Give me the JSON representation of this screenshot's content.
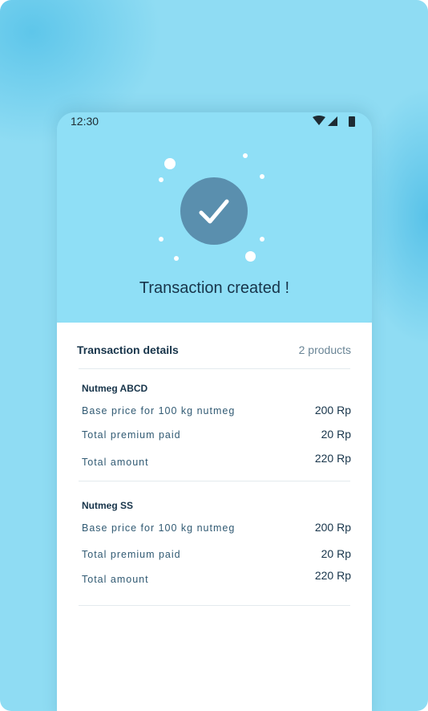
{
  "status_bar": {
    "time": "12:30",
    "icons": [
      "wifi-icon",
      "signal-icon",
      "battery-icon"
    ]
  },
  "hero": {
    "icon": "checkmark-icon",
    "title": "Transaction created !"
  },
  "details": {
    "title": "Transaction details",
    "count": "2 products",
    "products": [
      {
        "name": "Nutmeg ABCD",
        "rows": [
          {
            "label": "Base price for 100 kg nutmeg",
            "value": "200 Rp"
          },
          {
            "label": "Total premium paid",
            "value": "20 Rp"
          },
          {
            "label": "Total amount",
            "value": "220 Rp"
          }
        ]
      },
      {
        "name": "Nutmeg SS",
        "rows": [
          {
            "label": "Base price for 100 kg nutmeg",
            "value": "200 Rp"
          },
          {
            "label": "Total premium paid",
            "value": "20 Rp"
          },
          {
            "label": "Total amount",
            "value": "220 Rp"
          }
        ]
      }
    ]
  },
  "colors": {
    "background": "#8fdcf3",
    "hero": "#8fdff6",
    "check_circle": "#5a8fae",
    "text_dark": "#17344a",
    "text_label": "#315a73"
  }
}
